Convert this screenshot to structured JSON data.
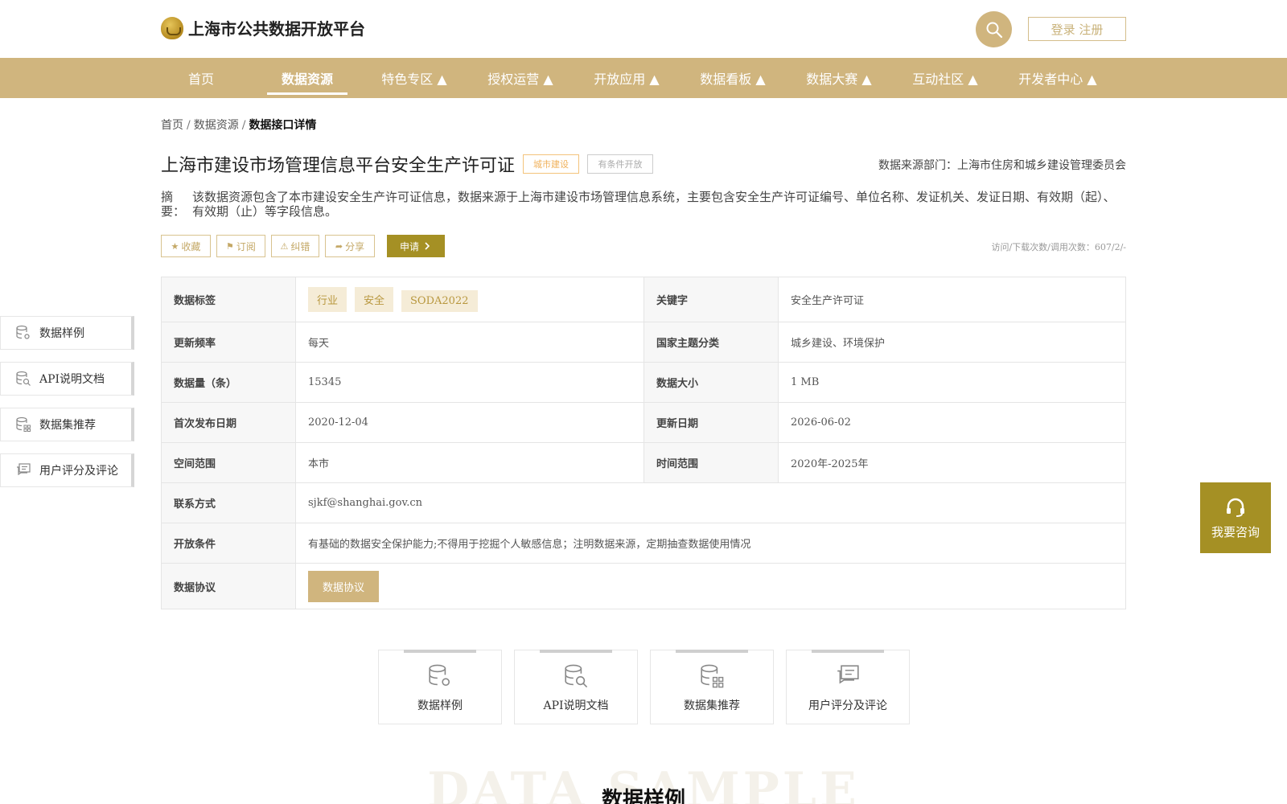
{
  "header": {
    "site_title": "上海市公共数据开放平台",
    "login_label": "登录 注册"
  },
  "nav": {
    "items": [
      {
        "label": "首页"
      },
      {
        "label": "数据资源"
      },
      {
        "label": "特色专区 ▲"
      },
      {
        "label": "授权运营 ▲"
      },
      {
        "label": "开放应用 ▲"
      },
      {
        "label": "数据看板 ▲"
      },
      {
        "label": "数据大赛 ▲"
      },
      {
        "label": "互动社区 ▲"
      },
      {
        "label": "开发者中心 ▲"
      }
    ],
    "active_index": 1
  },
  "breadcrumb": {
    "home": "首页",
    "sep": "/",
    "resources": "数据资源",
    "current": "数据接口详情"
  },
  "dataset": {
    "title": "上海市建设市场管理信息平台安全生产许可证",
    "tag_category": "城市建设",
    "tag_access": "有条件开放",
    "source_label": "数据来源部门：上海市住房和城乡建设管理委员会",
    "summary_label": "摘　要：",
    "summary_text": "该数据资源包含了本市建设安全生产许可证信息，数据来源于上海市建设市场管理信息系统，主要包含安全生产许可证编号、单位名称、发证机关、发证日期、有效期（起）、有效期（止）等字段信息。"
  },
  "actions": {
    "favorite": "收藏",
    "subscribe": "订阅",
    "report": "纠错",
    "share": "分享",
    "apply": "申请",
    "visits": "访问/下载次数/调用次数：607/2/-"
  },
  "info": {
    "tags_label": "数据标签",
    "tags": [
      "行业",
      "安全",
      "SODA2022"
    ],
    "keyword_label": "关键字",
    "keyword": "安全生产许可证",
    "freq_label": "更新频率",
    "freq": "每天",
    "theme_label": "国家主题分类",
    "theme": "城乡建设、环境保护",
    "count_label": "数据量（条）",
    "count": "15345",
    "size_label": "数据大小",
    "size": "1 MB",
    "first_pub_label": "首次发布日期",
    "first_pub": "2020-12-04",
    "updated_label": "更新日期",
    "updated": "2026-06-02",
    "space_label": "空间范围",
    "space": "本市",
    "time_label": "时间范围",
    "time": "2020年-2025年",
    "contact_label": "联系方式",
    "contact": "sjkf@shanghai.gov.cn",
    "condition_label": "开放条件",
    "condition": "有基础的数据安全保护能力;不得用于挖掘个人敏感信息；注明数据来源，定期抽查数据使用情况",
    "protocol_label": "数据协议",
    "protocol_button": "数据协议"
  },
  "side_menu": [
    {
      "label": "数据样例"
    },
    {
      "label": "API说明文档"
    },
    {
      "label": "数据集推荐"
    },
    {
      "label": "用户评分及评论"
    }
  ],
  "consult": {
    "label": "我要咨询"
  },
  "cards": [
    {
      "label": "数据样例"
    },
    {
      "label": "API说明文档"
    },
    {
      "label": "数据集推荐"
    },
    {
      "label": "用户评分及评论"
    }
  ],
  "section": {
    "bg_text": "DATA SAMPLE",
    "title": "数据样例"
  },
  "colors": {
    "brand": "#d0b57e",
    "accent": "#a59024"
  }
}
